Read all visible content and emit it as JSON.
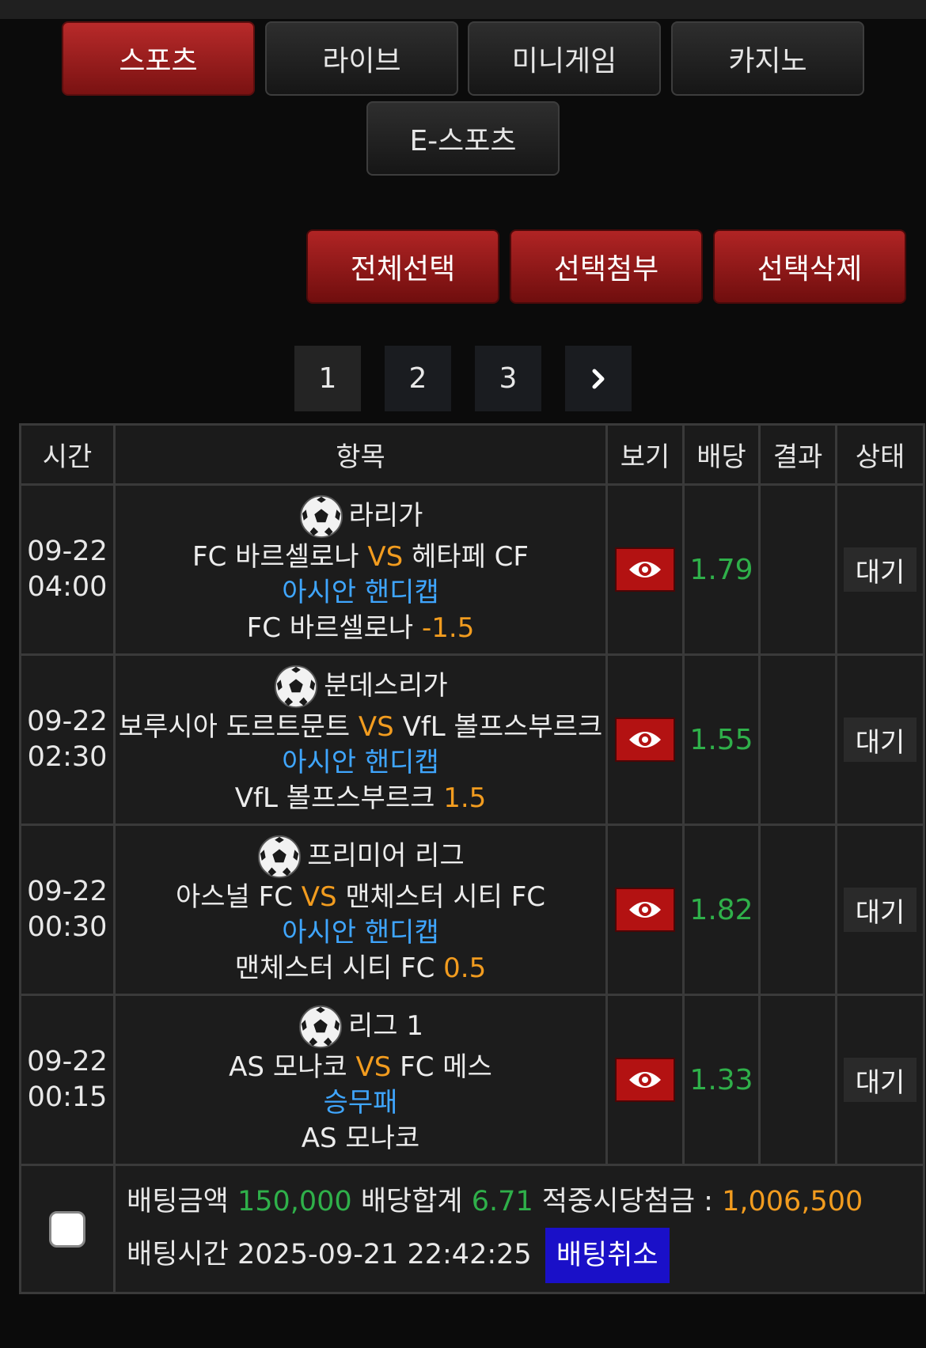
{
  "tabs": [
    {
      "label": "스포츠",
      "active": true
    },
    {
      "label": "라이브",
      "active": false
    },
    {
      "label": "미니게임",
      "active": false
    },
    {
      "label": "카지노",
      "active": false
    },
    {
      "label": "E-스포츠",
      "active": false
    }
  ],
  "actions": {
    "select_all": "전체선택",
    "attach_selected": "선택첨부",
    "delete_selected": "선택삭제"
  },
  "pagination": {
    "pages": [
      "1",
      "2",
      "3"
    ],
    "current": "1",
    "next_icon": "chevron-right-icon"
  },
  "table": {
    "headers": {
      "time": "시간",
      "item": "항목",
      "view": "보기",
      "odds": "배당",
      "result": "결과",
      "status": "상태"
    },
    "rows": [
      {
        "date": "09-22",
        "time": "04:00",
        "league": "라리가",
        "home": "FC 바르셀로나",
        "vs": "VS",
        "away": "헤타페 CF",
        "market": "아시안 핸디캡",
        "pick": "FC 바르셀로나",
        "line": "-1.5",
        "odds": "1.79",
        "result": "",
        "status": "대기"
      },
      {
        "date": "09-22",
        "time": "02:30",
        "league": "분데스리가",
        "home": "보루시아 도르트문트",
        "vs": "VS",
        "away": "VfL 볼프스부르크",
        "market": "아시안 핸디캡",
        "pick": "VfL 볼프스부르크",
        "line": "1.5",
        "odds": "1.55",
        "result": "",
        "status": "대기"
      },
      {
        "date": "09-22",
        "time": "00:30",
        "league": "프리미어 리그",
        "home": "아스널 FC",
        "vs": "VS",
        "away": "맨체스터 시티 FC",
        "market": "아시안 핸디캡",
        "pick": "맨체스터 시티 FC",
        "line": "0.5",
        "odds": "1.82",
        "result": "",
        "status": "대기"
      },
      {
        "date": "09-22",
        "time": "00:15",
        "league": "리그 1",
        "home": "AS 모나코",
        "vs": "VS",
        "away": "FC 메스",
        "market": "승무패",
        "pick": "AS 모나코",
        "line": "",
        "odds": "1.33",
        "result": "",
        "status": "대기"
      }
    ]
  },
  "summary": {
    "bet_amount_label": "배팅금액",
    "bet_amount": "150,000",
    "total_odds_label": "배당합계",
    "total_odds": "6.71",
    "payout_label": "적중시당첨금 :",
    "payout": "1,006,500",
    "bet_time_label": "배팅시간",
    "bet_time": "2025-09-21 22:42:25",
    "cancel_label": "배팅취소"
  },
  "colors": {
    "accent_red": "#b02424",
    "vs_orange": "#f29c1f",
    "market_blue": "#3fa6ff",
    "odds_green": "#2fb04a",
    "cancel_blue": "#1a10c8"
  }
}
